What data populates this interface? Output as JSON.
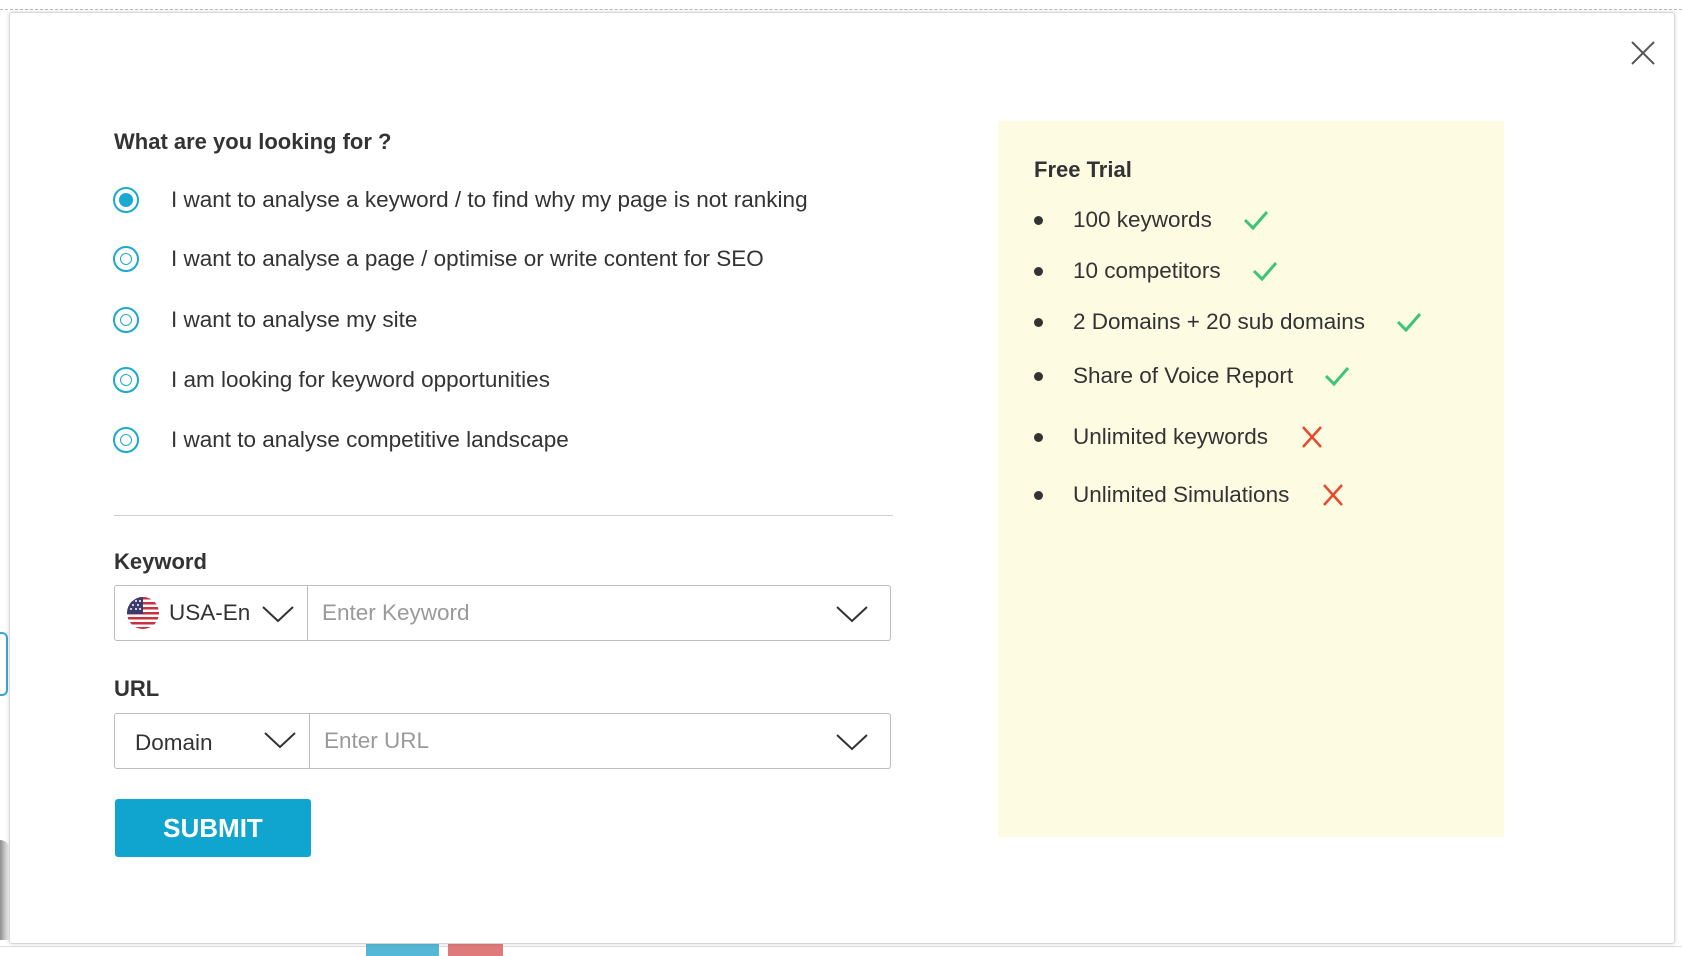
{
  "form": {
    "question": "What are you looking for ?",
    "options": [
      {
        "label": "I want to analyse a keyword / to find why my page is not ranking",
        "selected": true
      },
      {
        "label": "I want to analyse a page / optimise or  write content for SEO",
        "selected": false
      },
      {
        "label": "I want to analyse my site",
        "selected": false
      },
      {
        "label": "I am looking for keyword opportunities",
        "selected": false
      },
      {
        "label": "I want to analyse competitive landscape",
        "selected": false
      }
    ],
    "keyword": {
      "label": "Keyword",
      "locale_value": "USA-En",
      "placeholder": "Enter Keyword"
    },
    "url": {
      "label": "URL",
      "type_value": "Domain",
      "placeholder": "Enter URL"
    },
    "submit_label": "SUBMIT"
  },
  "trial": {
    "title": "Free Trial",
    "features": [
      {
        "text": "100 keywords",
        "included": true
      },
      {
        "text": "10 competitors",
        "included": true
      },
      {
        "text": "2 Domains + 20 sub domains",
        "included": true
      },
      {
        "text": "Share of Voice Report",
        "included": true
      },
      {
        "text": "Unlimited keywords",
        "included": false
      },
      {
        "text": "Unlimited Simulations",
        "included": false
      }
    ]
  },
  "colors": {
    "accent": "#10a5cf",
    "check": "#3cc47c",
    "cross": "#e8492b",
    "trial_bg": "#fefbe3"
  },
  "icons": {
    "close": "close-icon",
    "radio": "radio-icon",
    "chevron": "chevron-down-icon",
    "flag": "us-flag-icon",
    "check": "check-icon",
    "cross": "cross-icon"
  }
}
